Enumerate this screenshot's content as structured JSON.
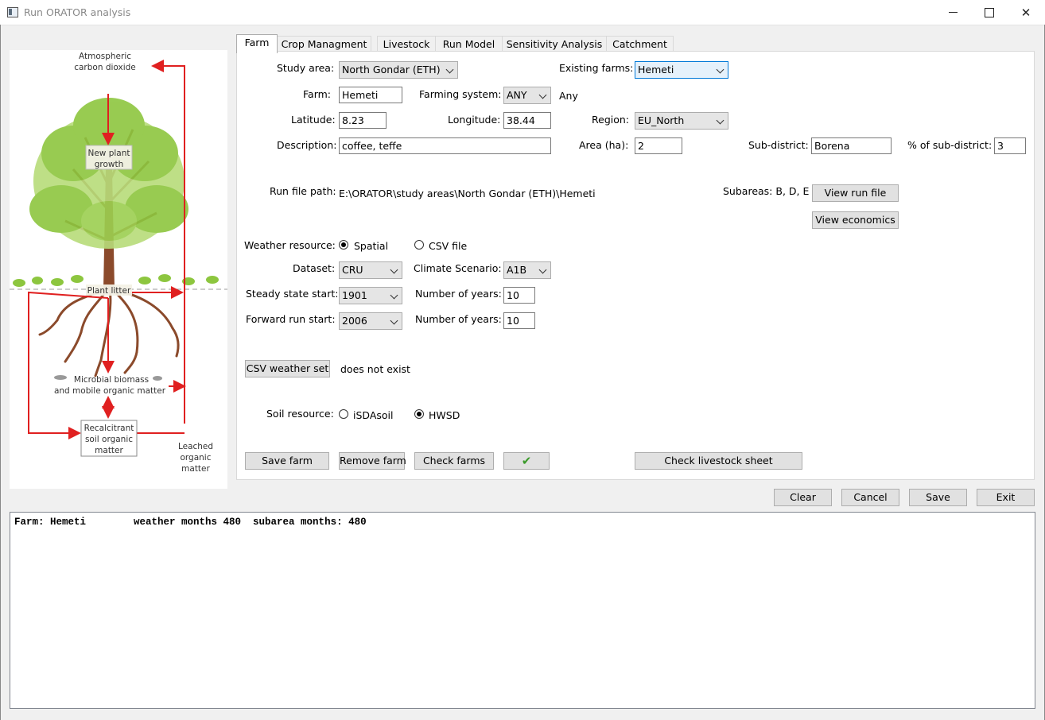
{
  "window": {
    "title": "Run ORATOR analysis",
    "minimize_glyph": "",
    "maximize_glyph": "",
    "close_glyph": "✕"
  },
  "diagram": {
    "atmospheric": [
      "Atmospheric",
      "carbon dioxide"
    ],
    "growth": [
      "New plant",
      "growth"
    ],
    "litter": "Plant litter",
    "microbial": [
      "Microbial biomass",
      "and mobile organic matter"
    ],
    "recalcitrant": [
      "Recalcitrant",
      "soil organic",
      "matter"
    ],
    "leached": [
      "Leached",
      "organic",
      "matter"
    ]
  },
  "tabs": [
    "Farm",
    "Crop Managment",
    "Livestock",
    "Run Model",
    "Sensitivity Analysis",
    "Catchment"
  ],
  "farm": {
    "study_area_label": "Study area:",
    "study_area": "North Gondar (ETH)",
    "existing_farms_label": "Existing farms:",
    "existing_farms": "Hemeti",
    "farm_label": "Farm:",
    "farm": "Hemeti",
    "farming_system_label": "Farming system:",
    "farming_system": "ANY",
    "farming_system_value": "Any",
    "latitude_label": "Latitude:",
    "latitude": "8.23",
    "longitude_label": "Longitude:",
    "longitude": "38.44",
    "region_label": "Region:",
    "region": "EU_North",
    "description_label": "Description:",
    "description": "coffee, teffe",
    "area_label": "Area (ha):",
    "area": "2",
    "subdistrict_label": "Sub-district:",
    "subdistrict": "Borena",
    "pct_subdistrict_label": "% of sub-district:",
    "pct_subdistrict": "3",
    "run_file_label": "Run file path:",
    "run_file_path": "E:\\ORATOR\\study areas\\North Gondar (ETH)\\Hemeti",
    "subareas": "Subareas: B, D, E",
    "view_run_file": "View run file",
    "view_economics": "View economics",
    "weather_label": "Weather resource:",
    "weather_spatial": "Spatial",
    "weather_csv": "CSV file",
    "dataset_label": "Dataset:",
    "dataset": "CRU",
    "climate_label": "Climate Scenario:",
    "climate": "A1B",
    "steady_label": "Steady state start:",
    "steady": "1901",
    "steady_years_label": "Number of years:",
    "steady_years": "10",
    "forward_label": "Forward run start:",
    "forward": "2006",
    "forward_years_label": "Number of years:",
    "forward_years": "10",
    "csv_weather_button": "CSV weather set",
    "csv_status": "does not exist",
    "soil_label": "Soil resource:",
    "soil_isda": "iSDAsoil",
    "soil_hwsd": "HWSD",
    "save_farm": "Save farm",
    "remove_farm": "Remove farm",
    "check_farms": "Check farms",
    "check_mark": "✔",
    "check_livestock": "Check livestock sheet"
  },
  "actions": {
    "clear": "Clear",
    "cancel": "Cancel",
    "save": "Save",
    "exit": "Exit"
  },
  "log": "Farm: Hemeti        weather months 480  subarea months: 480",
  "colors": {
    "arrow": "#e02020",
    "leaf": "#8dc63f",
    "trunk": "#8b4a2b"
  }
}
